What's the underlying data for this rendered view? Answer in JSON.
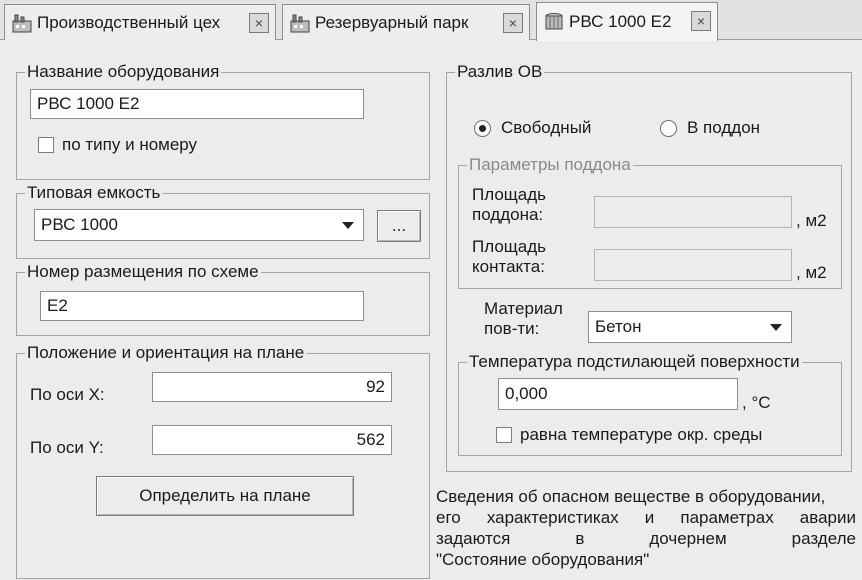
{
  "tabs": [
    {
      "label": "Производственный цех",
      "icon": "factory-icon",
      "close": "×"
    },
    {
      "label": "Резервуарный парк",
      "icon": "factory-icon",
      "close": "×"
    },
    {
      "label": "РВС 1000 Е2",
      "icon": "tank-icon",
      "close": "×",
      "active": true
    }
  ],
  "equipment_name": {
    "title": "Название оборудования",
    "value": "РВС 1000 Е2",
    "by_type_checkbox_label": "по типу и номеру",
    "by_type_checked": false
  },
  "typical_tank": {
    "title": "Типовая емкость",
    "selected": "РВС 1000",
    "browse_label": "..."
  },
  "placement_number": {
    "title": "Номер размещения по схеме",
    "value": "Е2"
  },
  "position": {
    "title": "Положение и ориентация на плане",
    "x_label": "По оси X:",
    "x_value": "92",
    "y_label": "По оси Y:",
    "y_value": "562",
    "locate_button": "Определить на плане"
  },
  "spill": {
    "title": "Разлив ОВ",
    "free_label": "Свободный",
    "tray_label": "В поддон",
    "selected": "free",
    "tray_params": {
      "title": "Параметры поддона",
      "area_label_1": "Площадь",
      "area_label_2": "поддона:",
      "area_value": "",
      "area_unit": ", м2",
      "contact_label_1": "Площадь",
      "contact_label_2": "контакта:",
      "contact_value": "",
      "contact_unit": ", м2"
    },
    "material_label_1": "Материал",
    "material_label_2": "пов-ти:",
    "material_selected": "Бетон",
    "temperature": {
      "title": "Температура подстилающей поверхности",
      "value": "0,000",
      "unit": ", °С",
      "ambient_checkbox_label": "равна температуре окр. среды",
      "ambient_checked": false
    }
  },
  "info": {
    "line1": "Сведения об опасном веществе в оборудовании,",
    "line2": "его характеристиках  и параметрах аварии",
    "line3": "задаются в дочернем разделе",
    "line4": "\"Состояние оборудования\""
  }
}
